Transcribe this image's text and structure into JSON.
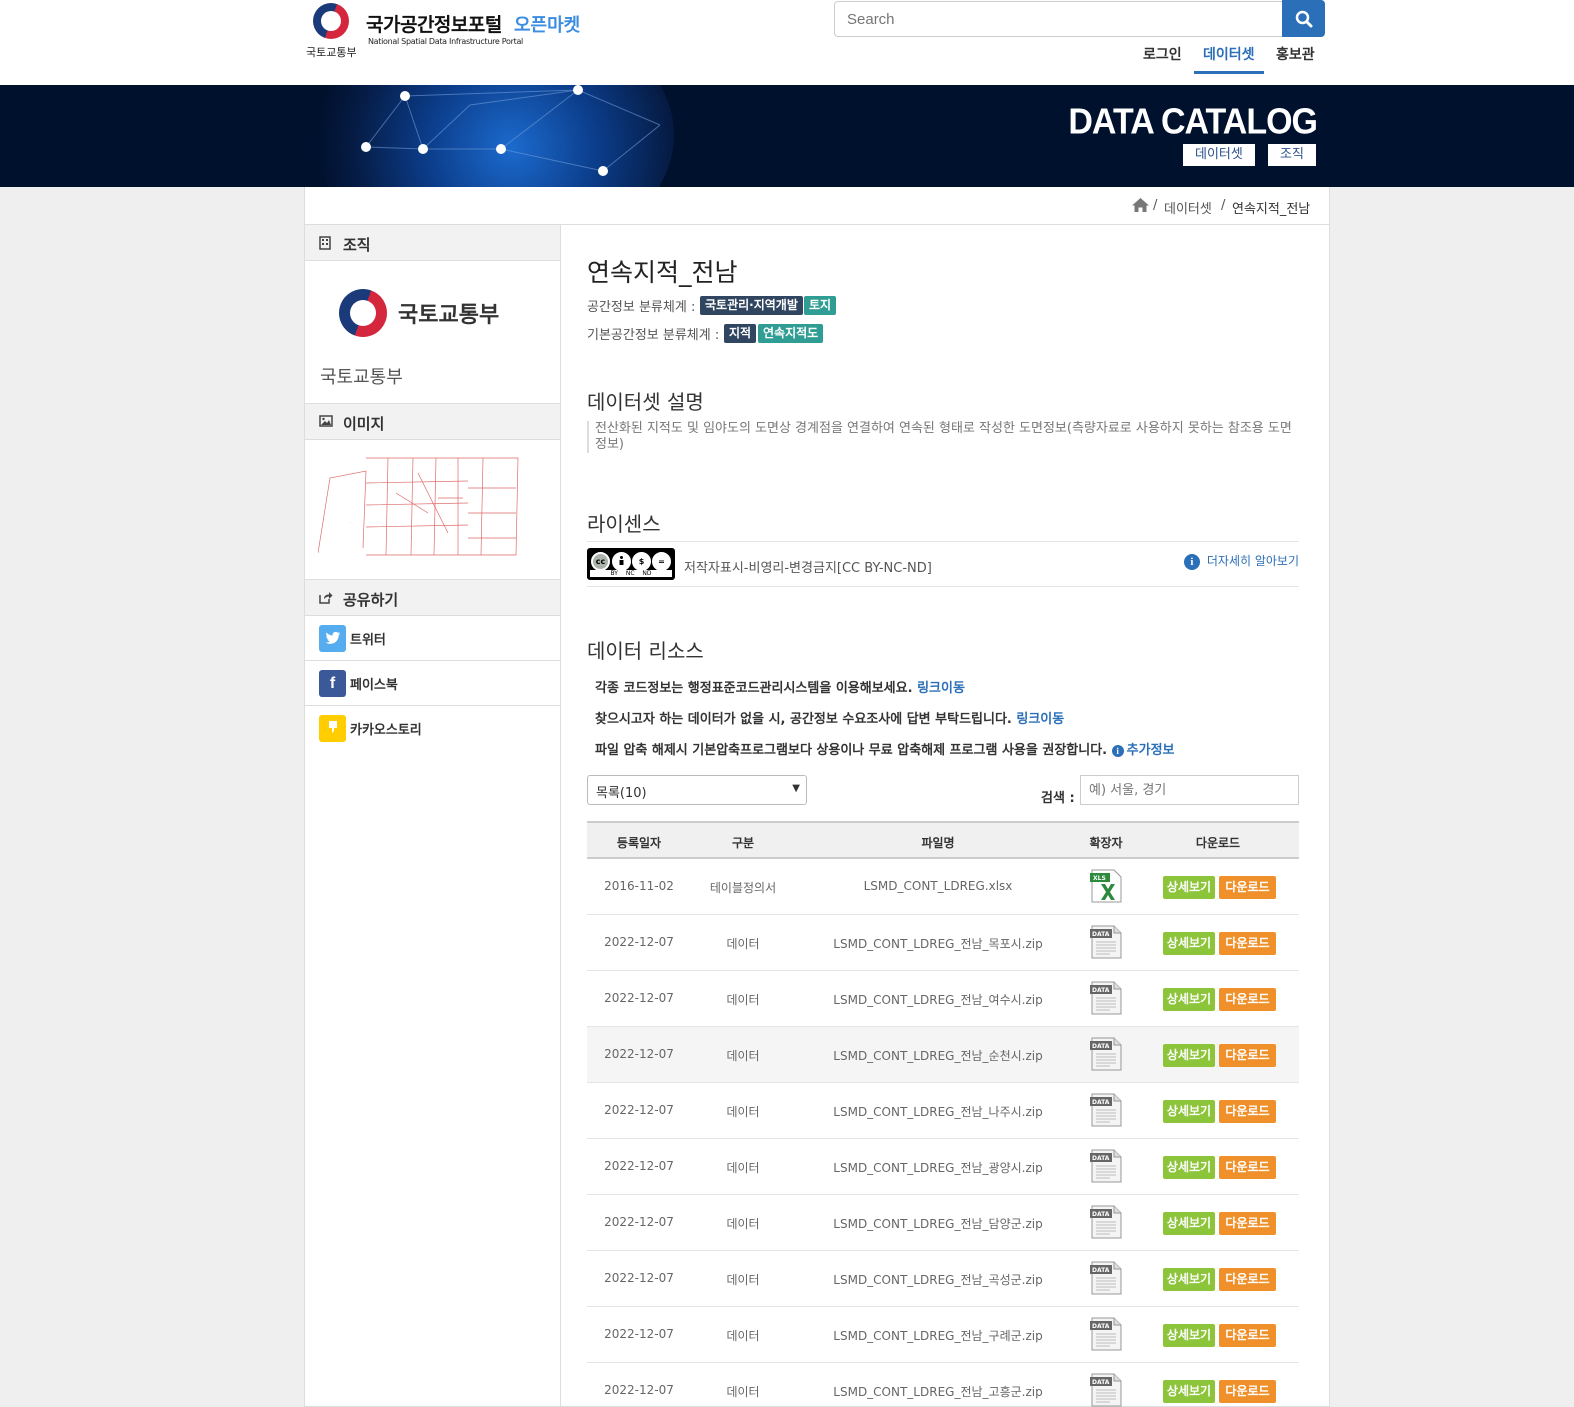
{
  "header": {
    "ministry": "국토교통부",
    "portal_title": "국가공간정보포털",
    "portal_subtitle": "National Spatial Data Infrastructure Portal",
    "market_label": "오픈마켓",
    "search_placeholder": "Search",
    "nav": [
      "로그인",
      "데이터셋",
      "홍보관"
    ],
    "active_nav": "데이터셋"
  },
  "banner": {
    "title": "DATA CATALOG",
    "buttons": [
      "데이터셋",
      "조직"
    ]
  },
  "breadcrumb": {
    "items": [
      "데이터셋",
      "연속지적_전남"
    ],
    "separator": "/"
  },
  "sidebar": {
    "org_heading": "조직",
    "org_logo_text": "국토교통부",
    "org_name": "국토교통부",
    "image_heading": "이미지",
    "share_heading": "공유하기",
    "share": [
      {
        "label": "트위터",
        "icon": "twitter-icon",
        "color": "#55acee"
      },
      {
        "label": "페이스북",
        "icon": "facebook-icon",
        "color": "#3b5998"
      },
      {
        "label": "카카오스토리",
        "icon": "kakaostory-icon",
        "color": "#ffcd00"
      }
    ]
  },
  "dataset": {
    "title": "연속지적_전남",
    "spatial_class_label": "공간정보 분류체계 :",
    "spatial_class_tags": [
      "국토관리·지역개발",
      "토지"
    ],
    "base_class_label": "기본공간정보 분류체계 :",
    "base_class_tags": [
      "지적",
      "연속지적도"
    ],
    "description_heading": "데이터셋 설명",
    "description": "전산화된 지적도 및 임야도의 도면상 경계점을 연결하여 연속된 형태로 작성한 도면정보(측량자료로 사용하지 못하는 참조용 도면정보)",
    "license_heading": "라이센스",
    "license_text": "저작자표시-비영리-변경금지[CC BY-NC-ND]",
    "license_badge": "BY NC ND",
    "license_more": "더자세히 알아보기",
    "resources_heading": "데이터 리소스",
    "notices": [
      {
        "text": "각종 코드정보는 행정표준코드관리시스템을 이용해보세요.",
        "link": "링크이동"
      },
      {
        "text": "찾으시고자 하는 데이터가 없을 시, 공간정보 수요조사에 답변 부탁드립니다.",
        "link": "링크이동"
      },
      {
        "text": "파일 압축 해제시 기본압축프로그램보다 상용이나 무료 압축해제 프로그램 사용을 권장합니다.",
        "link": "추가정보"
      }
    ],
    "page_size": "목록(10)",
    "search_label": "검색 :",
    "search_placeholder": "예) 서울, 경기"
  },
  "table": {
    "headers": [
      "등록일자",
      "구분",
      "파일명",
      "확장자",
      "다운로드"
    ],
    "detail_label": "상세보기",
    "download_label": "다운로드",
    "rows": [
      {
        "date": "2016-11-02",
        "type": "테이블정의서",
        "file": "LSMD_CONT_LDREG.xlsx",
        "ext": "xls"
      },
      {
        "date": "2022-12-07",
        "type": "데이터",
        "file": "LSMD_CONT_LDREG_전남_목포시.zip",
        "ext": "data"
      },
      {
        "date": "2022-12-07",
        "type": "데이터",
        "file": "LSMD_CONT_LDREG_전남_여수시.zip",
        "ext": "data"
      },
      {
        "date": "2022-12-07",
        "type": "데이터",
        "file": "LSMD_CONT_LDREG_전남_순천시.zip",
        "ext": "data"
      },
      {
        "date": "2022-12-07",
        "type": "데이터",
        "file": "LSMD_CONT_LDREG_전남_나주시.zip",
        "ext": "data"
      },
      {
        "date": "2022-12-07",
        "type": "데이터",
        "file": "LSMD_CONT_LDREG_전남_광양시.zip",
        "ext": "data"
      },
      {
        "date": "2022-12-07",
        "type": "데이터",
        "file": "LSMD_CONT_LDREG_전남_담양군.zip",
        "ext": "data"
      },
      {
        "date": "2022-12-07",
        "type": "데이터",
        "file": "LSMD_CONT_LDREG_전남_곡성군.zip",
        "ext": "data"
      },
      {
        "date": "2022-12-07",
        "type": "데이터",
        "file": "LSMD_CONT_LDREG_전남_구례군.zip",
        "ext": "data"
      },
      {
        "date": "2022-12-07",
        "type": "데이터",
        "file": "LSMD_CONT_LDREG_전남_고흥군.zip",
        "ext": "data"
      }
    ]
  },
  "colors": {
    "primary": "#2b6fb8",
    "banner_bg": "#00112d",
    "tag_dark": "#2f4560",
    "tag_teal": "#2f9d93",
    "detail_btn": "#8cc43a",
    "download_btn": "#f0902b"
  }
}
